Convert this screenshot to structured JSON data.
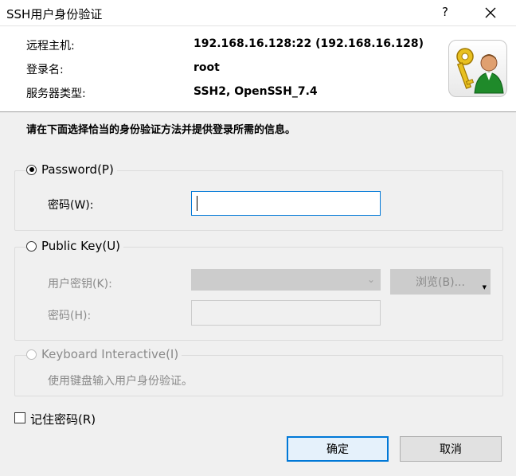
{
  "window": {
    "title": "SSH用户身份验证",
    "help_label": "?",
    "close_icon": "close-icon"
  },
  "header": {
    "host_label": "远程主机:",
    "host_value": "192.168.16.128:22 (192.168.16.128)",
    "login_label": "登录名:",
    "login_value": "root",
    "server_type_label": "服务器类型:",
    "server_type_value": "SSH2, OpenSSH_7.4",
    "icon": "user-key-icon"
  },
  "instruction": "请在下面选择恰当的身份验证方法并提供登录所需的信息。",
  "password_group": {
    "radio_label": "Password(P)",
    "selected": true,
    "password_label": "密码(W):",
    "password_value": ""
  },
  "public_key_group": {
    "radio_label": "Public Key(U)",
    "selected": false,
    "user_key_label": "用户密钥(K):",
    "user_key_value": "",
    "browse_label": "浏览(B)...",
    "passphrase_label": "密码(H):",
    "passphrase_value": ""
  },
  "keyboard_group": {
    "radio_label": "Keyboard Interactive(I)",
    "selected": false,
    "description": "使用键盘输入用户身份验证。"
  },
  "remember": {
    "label": "记住密码(R)",
    "checked": false
  },
  "buttons": {
    "ok_label": "确定",
    "cancel_label": "取消"
  },
  "colors": {
    "accent": "#0078d7",
    "window_bg": "#f0f0f0",
    "header_bg": "#ffffff",
    "disabled_text": "#8a8a8a"
  }
}
